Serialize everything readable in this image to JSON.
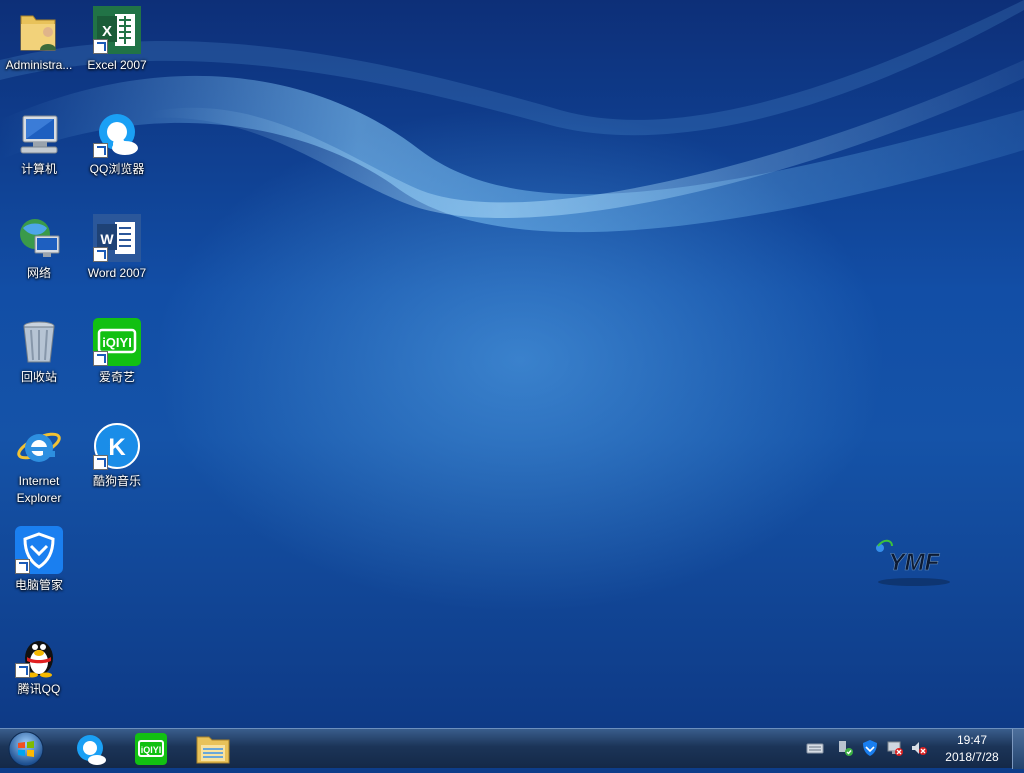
{
  "desktop": {
    "icons": [
      {
        "label": "Administra..."
      },
      {
        "label": "Excel 2007"
      },
      {
        "label": "计算机"
      },
      {
        "label": "QQ浏览器"
      },
      {
        "label": "网络"
      },
      {
        "label": "Word 2007"
      },
      {
        "label": "回收站"
      },
      {
        "label": "爱奇艺"
      },
      {
        "label": "Internet Explorer"
      },
      {
        "label": "酷狗音乐"
      },
      {
        "label": "电脑管家"
      },
      {
        "label": "腾讯QQ"
      }
    ],
    "logo_text": "YMF"
  },
  "taskbar": {
    "pinned": [
      {
        "icon": "qq-browser-icon"
      },
      {
        "icon": "iqiyi-icon"
      },
      {
        "icon": "file-explorer-icon"
      }
    ],
    "tray": [
      {
        "icon": "keyboard-icon"
      },
      {
        "icon": "usb-icon"
      },
      {
        "icon": "security-shield-icon"
      },
      {
        "icon": "network-icon"
      },
      {
        "icon": "volume-muted-icon"
      }
    ],
    "clock": {
      "time": "19:47",
      "date": "2018/7/28"
    }
  },
  "colors": {
    "accent": "#1a5bb0",
    "taskbar": "#1f3a60"
  }
}
